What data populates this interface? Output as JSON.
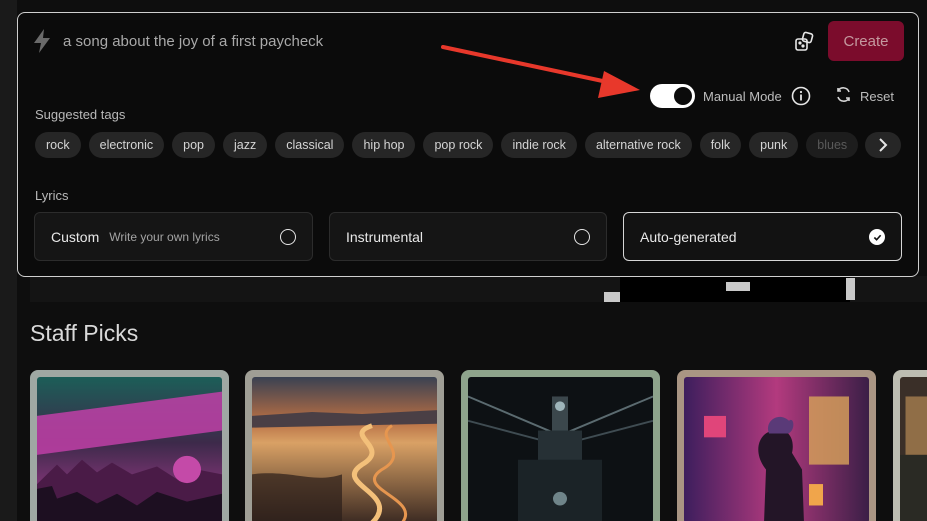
{
  "prompt": {
    "placeholder": "a song about the joy of a first paycheck"
  },
  "header": {
    "create_label": "Create",
    "manual_mode_label": "Manual Mode",
    "manual_mode_on": true,
    "reset_label": "Reset"
  },
  "tags": {
    "heading": "Suggested tags",
    "items": [
      "rock",
      "electronic",
      "pop",
      "jazz",
      "classical",
      "hip hop",
      "pop rock",
      "indie rock",
      "alternative rock",
      "folk",
      "punk",
      "blues"
    ]
  },
  "lyrics": {
    "heading": "Lyrics",
    "options": [
      {
        "title": "Custom",
        "subtitle": "Write your own lyrics",
        "selected": false
      },
      {
        "title": "Instrumental",
        "subtitle": "",
        "selected": false
      },
      {
        "title": "Auto-generated",
        "subtitle": "",
        "selected": true
      }
    ]
  },
  "staff_picks": {
    "title": "Staff Picks"
  },
  "colors": {
    "accent": "#7b0c2c",
    "annotation_arrow": "#e8382b"
  }
}
